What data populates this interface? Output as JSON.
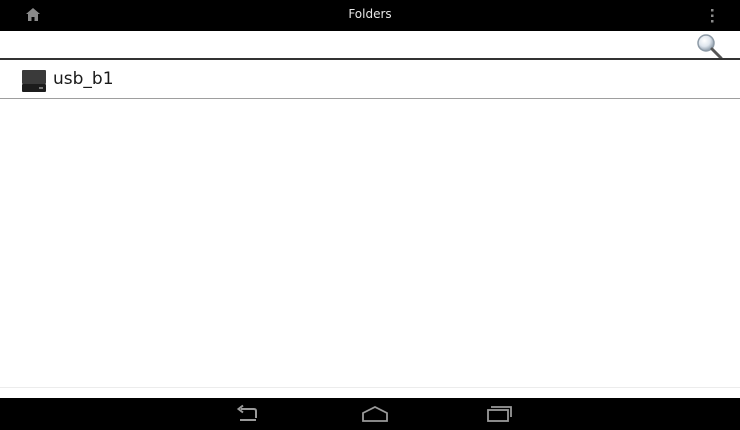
{
  "actionbar": {
    "title": "Folders",
    "home_icon": "home-icon",
    "overflow_icon": "overflow-menu-icon"
  },
  "search": {
    "value": "",
    "placeholder": "",
    "icon": "search-icon"
  },
  "folders": {
    "items": [
      {
        "label": "usb_b1",
        "icon": "usb-drive-icon"
      }
    ]
  },
  "navbar": {
    "back_icon": "back-icon",
    "home_icon": "home-outline-icon",
    "recents_icon": "recent-apps-icon"
  },
  "colors": {
    "bar_background": "#000000",
    "title_text": "#e6e6e6",
    "list_background": "#ffffff"
  }
}
